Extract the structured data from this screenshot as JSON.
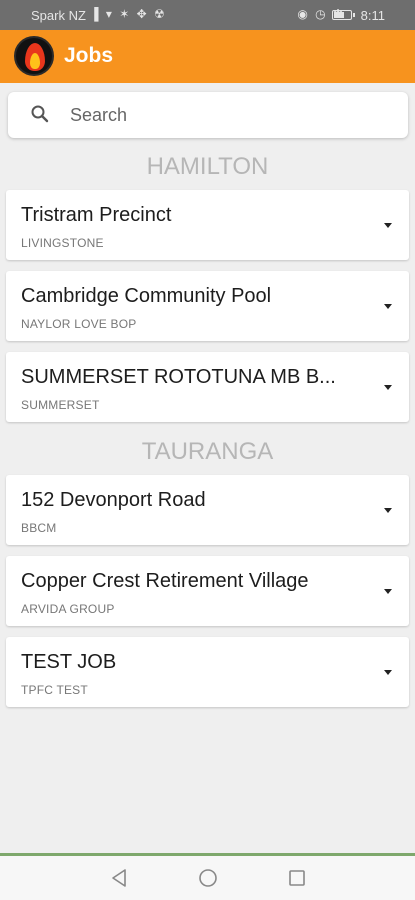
{
  "status_bar": {
    "carrier": "Spark NZ",
    "left_icons": "▐ ▾ ✶ ✥ ☢",
    "right_icons": "◉ ◷ ✱",
    "time": "8:11",
    "battery_level": 0.6
  },
  "app_bar": {
    "title": "Jobs"
  },
  "search": {
    "placeholder": "Search"
  },
  "groups": [
    {
      "region": "HAMILTON",
      "jobs": [
        {
          "name": "Tristram Precinct",
          "client": "LIVINGSTONE"
        },
        {
          "name": "Cambridge Community Pool",
          "client": "NAYLOR LOVE BOP"
        },
        {
          "name": "SUMMERSET ROTOTUNA MB B...",
          "client": "SUMMERSET"
        }
      ]
    },
    {
      "region": "TAURANGA",
      "jobs": [
        {
          "name": "152 Devonport Road",
          "client": "BBCM"
        },
        {
          "name": "Copper Crest Retirement Village",
          "client": "ARVIDA GROUP"
        },
        {
          "name": "TEST JOB",
          "client": "TPFC TEST"
        }
      ]
    }
  ],
  "colors": {
    "accent": "#f7931e",
    "status_bar": "#6e6e6e",
    "background": "#efefef",
    "group_header": "#b6b6b6",
    "nav_divider": "#7ea86c"
  },
  "icons": {
    "search": "search-icon",
    "dropdown": "caret-down-icon",
    "logo": "fire-logo",
    "nav_back": "back-triangle-icon",
    "nav_home": "home-circle-icon",
    "nav_recents": "recents-square-icon"
  }
}
